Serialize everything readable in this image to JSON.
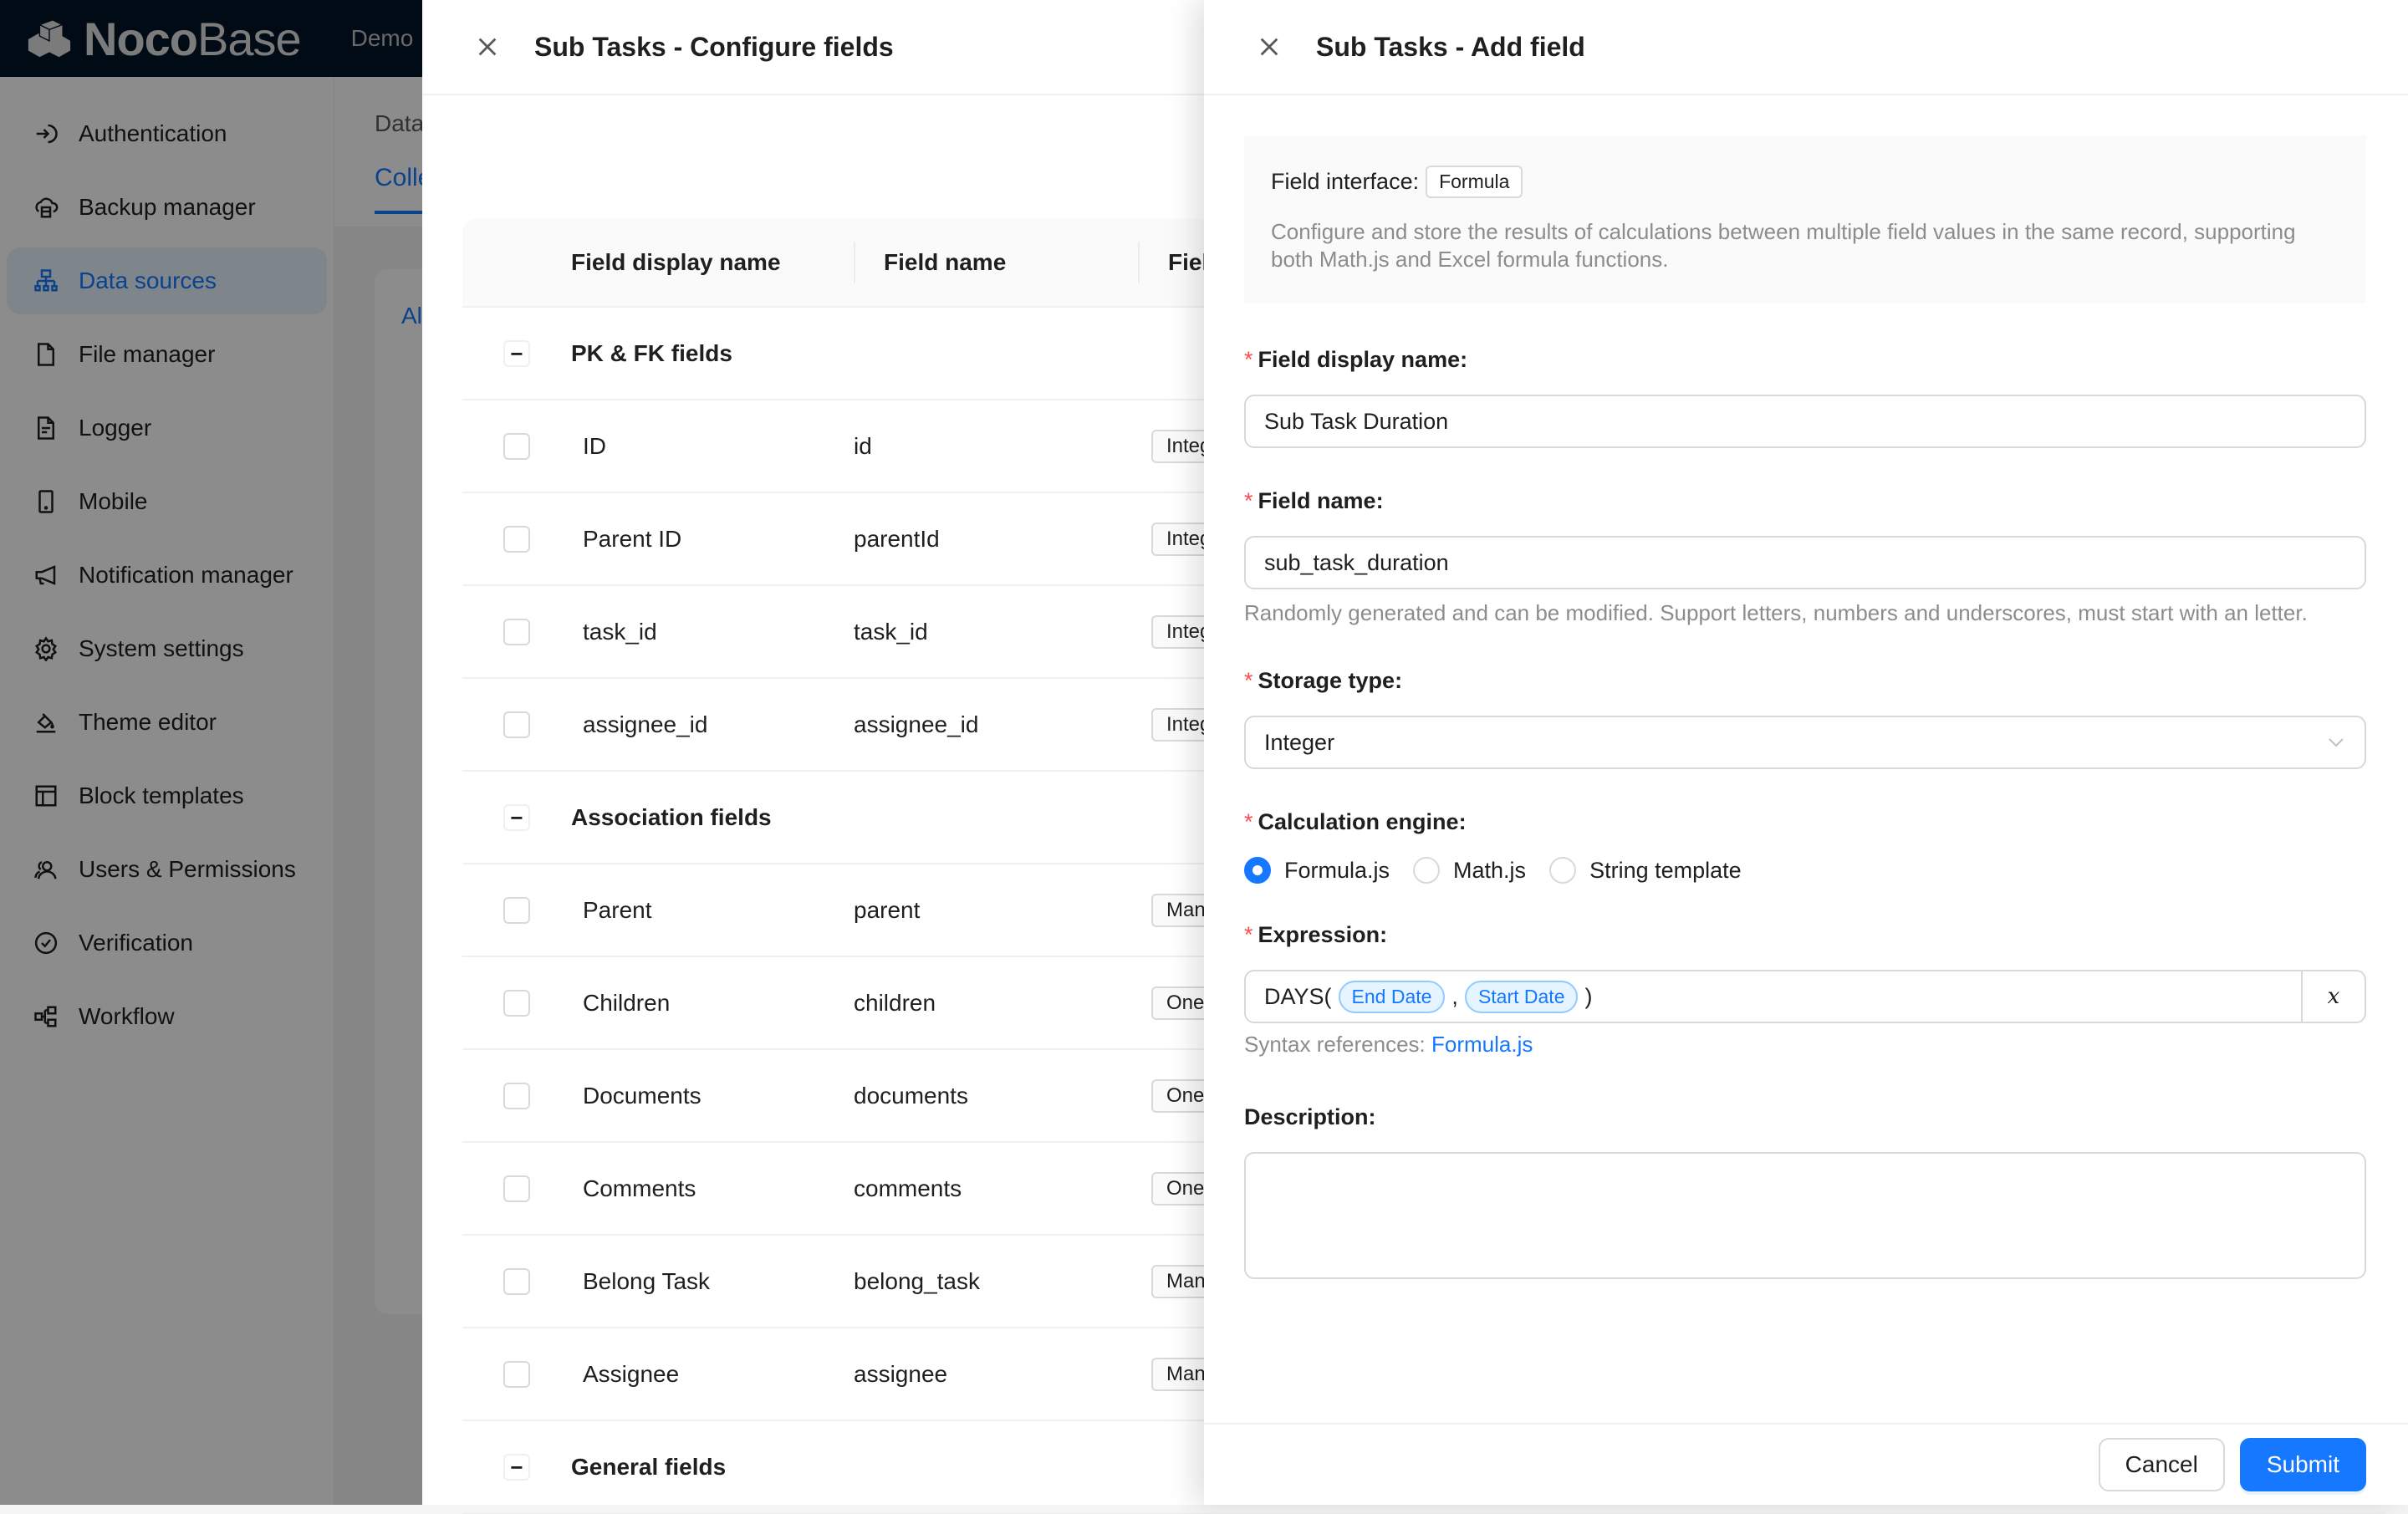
{
  "app": {
    "logo_bold": "Noco",
    "logo_light": "Base",
    "top_nav_item": "Demo"
  },
  "sidebar": {
    "items": [
      {
        "label": "Authentication",
        "icon": "login-icon",
        "active": false
      },
      {
        "label": "Backup manager",
        "icon": "cloud-server-icon",
        "active": false
      },
      {
        "label": "Data sources",
        "icon": "cluster-icon",
        "active": true
      },
      {
        "label": "File manager",
        "icon": "file-icon",
        "active": false
      },
      {
        "label": "Logger",
        "icon": "file-text-icon",
        "active": false
      },
      {
        "label": "Mobile",
        "icon": "mobile-icon",
        "active": false
      },
      {
        "label": "Notification manager",
        "icon": "notification-icon",
        "active": false
      },
      {
        "label": "System settings",
        "icon": "setting-icon",
        "active": false
      },
      {
        "label": "Theme editor",
        "icon": "bg-colors-icon",
        "active": false
      },
      {
        "label": "Block templates",
        "icon": "layout-icon",
        "active": false
      },
      {
        "label": "Users & Permissions",
        "icon": "team-icon",
        "active": false
      },
      {
        "label": "Verification",
        "icon": "check-circle-icon",
        "active": false
      },
      {
        "label": "Workflow",
        "icon": "partition-icon",
        "active": false
      }
    ]
  },
  "main": {
    "breadcrumb": "Data",
    "tab": "Colle",
    "card_tab": "Al"
  },
  "configure_drawer": {
    "title": "Sub Tasks - Configure fields",
    "columns": [
      "Field display name",
      "Field name",
      "Field i"
    ],
    "groups": [
      {
        "label": "PK & FK fields",
        "rows": [
          {
            "display": "ID",
            "name": "id",
            "type": "Intege"
          },
          {
            "display": "Parent ID",
            "name": "parentId",
            "type": "Intege"
          },
          {
            "display": "task_id",
            "name": "task_id",
            "type": "Intege"
          },
          {
            "display": "assignee_id",
            "name": "assignee_id",
            "type": "Intege"
          }
        ]
      },
      {
        "label": "Association fields",
        "rows": [
          {
            "display": "Parent",
            "name": "parent",
            "type": "Many"
          },
          {
            "display": "Children",
            "name": "children",
            "type": "One to"
          },
          {
            "display": "Documents",
            "name": "documents",
            "type": "One to"
          },
          {
            "display": "Comments",
            "name": "comments",
            "type": "One to"
          },
          {
            "display": "Belong Task",
            "name": "belong_task",
            "type": "Many"
          },
          {
            "display": "Assignee",
            "name": "assignee",
            "type": "Many"
          }
        ]
      },
      {
        "label": "General fields",
        "rows": []
      }
    ]
  },
  "add_field_drawer": {
    "title": "Sub Tasks - Add field",
    "interface_label": "Field interface:",
    "interface_value": "Formula",
    "interface_desc": "Configure and store the results of calculations between multiple field values in the same record, supporting both Math.js and Excel formula functions.",
    "display_name": {
      "label": "Field display name",
      "value": "Sub Task Duration",
      "required": true
    },
    "field_name": {
      "label": "Field name",
      "value": "sub_task_duration",
      "required": true,
      "help": "Randomly generated and can be modified. Support letters, numbers and underscores, must start with an letter."
    },
    "storage_type": {
      "label": "Storage type",
      "value": "Integer",
      "required": true
    },
    "engine": {
      "label": "Calculation engine",
      "required": true,
      "options": [
        {
          "label": "Formula.js",
          "checked": true
        },
        {
          "label": "Math.js",
          "checked": false
        },
        {
          "label": "String template",
          "checked": false
        }
      ]
    },
    "expression": {
      "label": "Expression",
      "required": true,
      "func_open": "DAYS(",
      "var1": "End Date",
      "sep": ",",
      "var2": "Start Date",
      "func_close": ")",
      "var_button": "x",
      "syntax_label": "Syntax references:",
      "syntax_link": "Formula.js"
    },
    "description": {
      "label": "Description",
      "value": ""
    },
    "cancel_label": "Cancel",
    "submit_label": "Submit"
  },
  "colors": {
    "primary": "#1677ff",
    "required": "#ff4d4f",
    "header_bg": "#001529"
  }
}
